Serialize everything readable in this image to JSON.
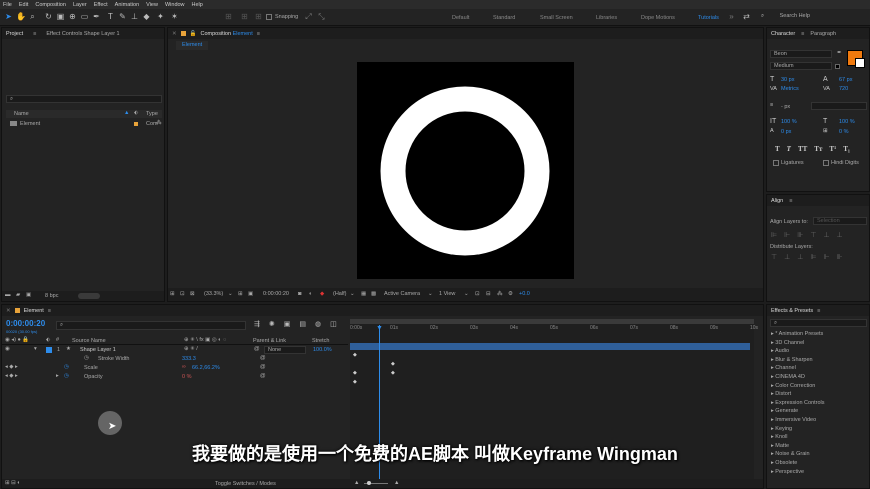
{
  "menu": [
    "File",
    "Edit",
    "Composition",
    "Layer",
    "Effect",
    "Animation",
    "View",
    "Window",
    "Help"
  ],
  "toolbar": {
    "snapping_label": "Snapping",
    "workspaces": [
      "Default",
      "Standard",
      "Small Screen",
      "Libraries",
      "Dope Motions",
      "Tutorials"
    ],
    "active_workspace": "Tutorials",
    "search_placeholder": "Search Help"
  },
  "project_panel": {
    "tab_project": "Project",
    "tab_effect_controls": "Effect Controls Shape Layer 1",
    "col_name": "Name",
    "col_type": "Type",
    "item_name": "Element",
    "item_type": "Com",
    "bpc": "8 bpc"
  },
  "composition_panel": {
    "tab_prefix": "Composition",
    "tab_name": "Element",
    "breadcrumb": "Element",
    "zoom": "(33.3%)",
    "timecode": "0:00:00:20",
    "resolution": "(Half)",
    "camera": "Active Camera",
    "view": "1 View",
    "exposure": "+0.0"
  },
  "character_panel": {
    "tab_character": "Character",
    "tab_paragraph": "Paragraph",
    "font": "Beon",
    "style": "Medium",
    "font_size": "30 px",
    "leading": "67 px",
    "kerning": "Metrics",
    "tracking": "720",
    "stroke_unit": "- px",
    "vert_scale": "100 %",
    "horiz_scale": "100 %",
    "baseline": "0 px",
    "tsume": "0 %",
    "ligatures": "Ligatures",
    "hindi_digits": "Hindi Digits",
    "fill_color": "#f07a0e"
  },
  "align_panel": {
    "tab": "Align",
    "align_to_label": "Align Layers to:",
    "align_to_value": "Selection",
    "distribute_label": "Distribute Layers:"
  },
  "effects_panel": {
    "tab": "Effects & Presets",
    "items": [
      "* Animation Presets",
      "3D Channel",
      "Audio",
      "Blur & Sharpen",
      "Channel",
      "CINEMA 4D",
      "Color Correction",
      "Distort",
      "Expression Controls",
      "Generate",
      "Immersive Video",
      "Keying",
      "Knoll",
      "Matte",
      "Noise & Grain",
      "Obsolete",
      "Perspective"
    ]
  },
  "timeline": {
    "tab": "Element",
    "timecode": "0:00:00:20",
    "frame_info": "00020 (30.00 fps)",
    "col_source": "Source Name",
    "col_parent": "Parent & Link",
    "col_stretch": "Stretch",
    "layer_number": "1",
    "layer_name": "Shape Layer 1",
    "parent_value": "None",
    "stretch_value": "100.0%",
    "props": [
      {
        "name": "Stroke Width",
        "value": "333.3"
      },
      {
        "name": "Scale",
        "value": "66.2,66.2%"
      },
      {
        "name": "Opacity",
        "value": "0 %"
      }
    ],
    "ruler": [
      "0:00s",
      "01s",
      "02s",
      "03s",
      "04s",
      "05s",
      "06s",
      "07s",
      "08s",
      "09s",
      "10s"
    ],
    "footer": "Toggle Switches / Modes"
  },
  "subtitle": "我要做的是使用一个免费的AE脚本 叫做Keyframe Wingman"
}
